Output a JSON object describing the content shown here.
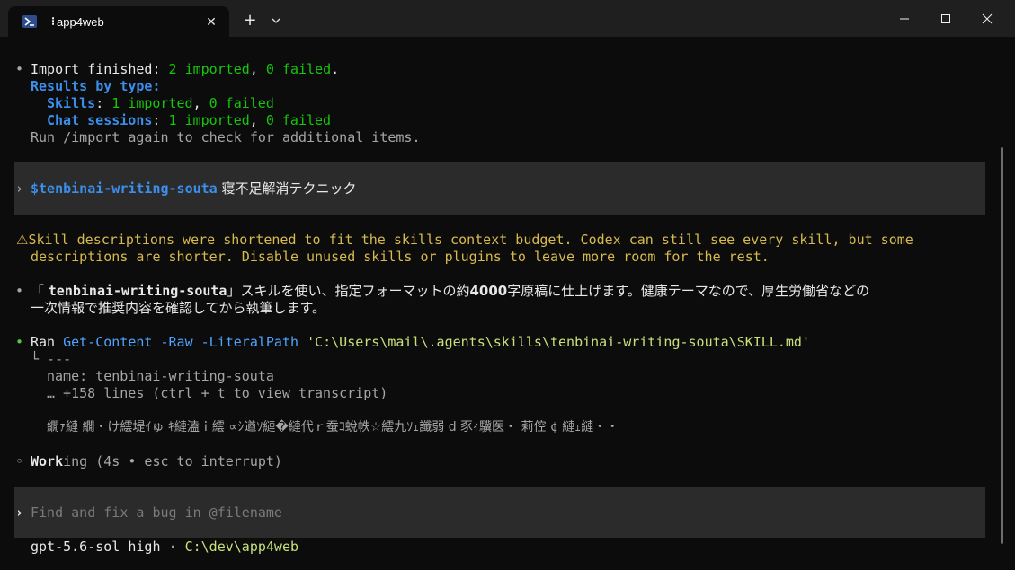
{
  "window": {
    "tab_title": "app4web",
    "tab_busy_glyph": "⁝",
    "tab_close": "✕",
    "new_tab": "+",
    "accent": "#3b8eea"
  },
  "terminal": {
    "import": {
      "bullet": "•",
      "line1_a": "Import finished: ",
      "line1_b": "2 imported",
      "line1_c": ", ",
      "line1_d": "0 failed",
      "line1_e": ".",
      "results_by_type": "Results by type:",
      "skills_label": "Skills",
      "skills_colon": ": ",
      "skills_imported": "1 imported",
      "skills_sep": ", ",
      "skills_failed": "0 failed",
      "chat_label": "Chat sessions",
      "chat_colon": ": ",
      "chat_imported": "1 imported",
      "chat_sep": ", ",
      "chat_failed": "0 failed",
      "run_again": "Run /import again to check for additional items."
    },
    "user_prompt": {
      "marker": "›",
      "skill": "$tenbinai-writing-souta",
      "text": " 寝不足解消テクニック"
    },
    "warning": {
      "icon": "⚠",
      "line1": "Skill descriptions were shortened to fit the skills context budget. Codex can still see every skill, but some",
      "line2": "descriptions are shorter. Disable unused skills or plugins to leave more room for the rest."
    },
    "assistant": {
      "bullet": "•",
      "line1_a": "「 ",
      "line1_skill": "tenbinai-writing-souta",
      "line1_b": "」スキルを使い、指定フォーマットの約",
      "line1_num": "4000",
      "line1_c": "字原稿に仕上げます。健康テーマなので、厚生労働省などの",
      "line2": "一次情報で推奨内容を確認してから執筆します。"
    },
    "ran": {
      "bullet": "•",
      "ran": "Ran",
      "cmd": "Get-Content",
      "flag1": "-Raw",
      "flag2": "-LiteralPath",
      "path": "'C:\\Users\\mail\\.agents\\skills\\tenbinai-writing-souta\\SKILL.md'",
      "out1": "└ ---",
      "out2": "name: tenbinai-writing-souta",
      "out3": "… +158 lines (ctrl + t to view transcript)",
      "out4": "繝ｧ縺 繝・け繧堤ｲゅ ｷ縺溘ｉ繧 ∝ｼ遒ｿ縺�縺代ｒ蚕ｺ蛻帙☆繧九ｿｪ讖弱 d 豕ｨ驥医・ 莉倥 ¢ 縺ｪ縺・・"
    },
    "working": {
      "bullet": "◦",
      "bold": "Work",
      "rest": "ing (4s • esc to interrupt)"
    },
    "input": {
      "marker": "›",
      "placeholder": "Find and fix a bug in @filename"
    },
    "status": {
      "model": "gpt-5.6-sol high",
      "sep": " · ",
      "cwd": "C:\\dev\\app4web"
    }
  }
}
